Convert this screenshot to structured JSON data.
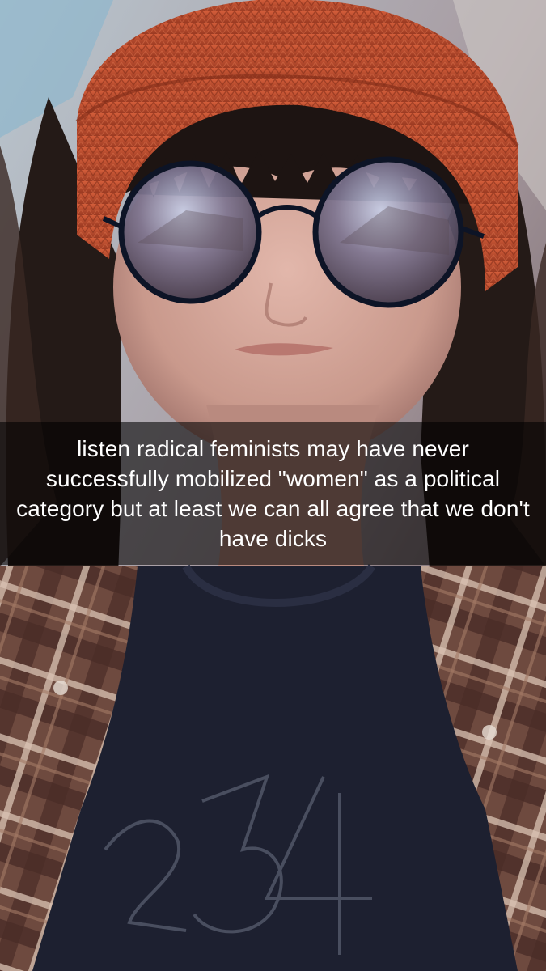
{
  "caption": {
    "text": "listen radical feminists may have never successfully mobilized \"women\" as a political category but at least we can all agree that we don't have dicks"
  },
  "colors": {
    "beanie": "#b8482a",
    "hair": "#241a17",
    "skin": "#c99f93",
    "lens_rim": "#0d1426",
    "shirt": "#1d2030",
    "flannel": "#7b5446",
    "caption_bg": "#000000"
  }
}
